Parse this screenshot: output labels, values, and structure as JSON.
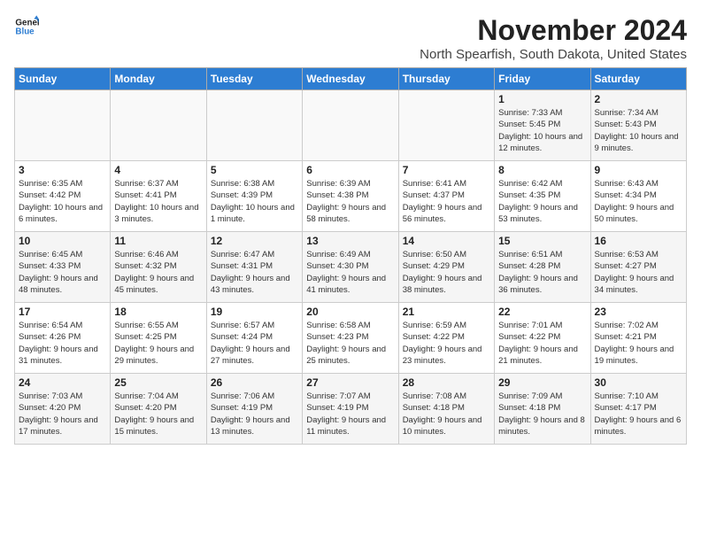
{
  "header": {
    "logo_line1": "General",
    "logo_line2": "Blue",
    "month_title": "November 2024",
    "location": "North Spearfish, South Dakota, United States"
  },
  "days_of_week": [
    "Sunday",
    "Monday",
    "Tuesday",
    "Wednesday",
    "Thursday",
    "Friday",
    "Saturday"
  ],
  "weeks": [
    [
      {
        "day": "",
        "info": ""
      },
      {
        "day": "",
        "info": ""
      },
      {
        "day": "",
        "info": ""
      },
      {
        "day": "",
        "info": ""
      },
      {
        "day": "",
        "info": ""
      },
      {
        "day": "1",
        "info": "Sunrise: 7:33 AM\nSunset: 5:45 PM\nDaylight: 10 hours and 12 minutes."
      },
      {
        "day": "2",
        "info": "Sunrise: 7:34 AM\nSunset: 5:43 PM\nDaylight: 10 hours and 9 minutes."
      }
    ],
    [
      {
        "day": "3",
        "info": "Sunrise: 6:35 AM\nSunset: 4:42 PM\nDaylight: 10 hours and 6 minutes."
      },
      {
        "day": "4",
        "info": "Sunrise: 6:37 AM\nSunset: 4:41 PM\nDaylight: 10 hours and 3 minutes."
      },
      {
        "day": "5",
        "info": "Sunrise: 6:38 AM\nSunset: 4:39 PM\nDaylight: 10 hours and 1 minute."
      },
      {
        "day": "6",
        "info": "Sunrise: 6:39 AM\nSunset: 4:38 PM\nDaylight: 9 hours and 58 minutes."
      },
      {
        "day": "7",
        "info": "Sunrise: 6:41 AM\nSunset: 4:37 PM\nDaylight: 9 hours and 56 minutes."
      },
      {
        "day": "8",
        "info": "Sunrise: 6:42 AM\nSunset: 4:35 PM\nDaylight: 9 hours and 53 minutes."
      },
      {
        "day": "9",
        "info": "Sunrise: 6:43 AM\nSunset: 4:34 PM\nDaylight: 9 hours and 50 minutes."
      }
    ],
    [
      {
        "day": "10",
        "info": "Sunrise: 6:45 AM\nSunset: 4:33 PM\nDaylight: 9 hours and 48 minutes."
      },
      {
        "day": "11",
        "info": "Sunrise: 6:46 AM\nSunset: 4:32 PM\nDaylight: 9 hours and 45 minutes."
      },
      {
        "day": "12",
        "info": "Sunrise: 6:47 AM\nSunset: 4:31 PM\nDaylight: 9 hours and 43 minutes."
      },
      {
        "day": "13",
        "info": "Sunrise: 6:49 AM\nSunset: 4:30 PM\nDaylight: 9 hours and 41 minutes."
      },
      {
        "day": "14",
        "info": "Sunrise: 6:50 AM\nSunset: 4:29 PM\nDaylight: 9 hours and 38 minutes."
      },
      {
        "day": "15",
        "info": "Sunrise: 6:51 AM\nSunset: 4:28 PM\nDaylight: 9 hours and 36 minutes."
      },
      {
        "day": "16",
        "info": "Sunrise: 6:53 AM\nSunset: 4:27 PM\nDaylight: 9 hours and 34 minutes."
      }
    ],
    [
      {
        "day": "17",
        "info": "Sunrise: 6:54 AM\nSunset: 4:26 PM\nDaylight: 9 hours and 31 minutes."
      },
      {
        "day": "18",
        "info": "Sunrise: 6:55 AM\nSunset: 4:25 PM\nDaylight: 9 hours and 29 minutes."
      },
      {
        "day": "19",
        "info": "Sunrise: 6:57 AM\nSunset: 4:24 PM\nDaylight: 9 hours and 27 minutes."
      },
      {
        "day": "20",
        "info": "Sunrise: 6:58 AM\nSunset: 4:23 PM\nDaylight: 9 hours and 25 minutes."
      },
      {
        "day": "21",
        "info": "Sunrise: 6:59 AM\nSunset: 4:22 PM\nDaylight: 9 hours and 23 minutes."
      },
      {
        "day": "22",
        "info": "Sunrise: 7:01 AM\nSunset: 4:22 PM\nDaylight: 9 hours and 21 minutes."
      },
      {
        "day": "23",
        "info": "Sunrise: 7:02 AM\nSunset: 4:21 PM\nDaylight: 9 hours and 19 minutes."
      }
    ],
    [
      {
        "day": "24",
        "info": "Sunrise: 7:03 AM\nSunset: 4:20 PM\nDaylight: 9 hours and 17 minutes."
      },
      {
        "day": "25",
        "info": "Sunrise: 7:04 AM\nSunset: 4:20 PM\nDaylight: 9 hours and 15 minutes."
      },
      {
        "day": "26",
        "info": "Sunrise: 7:06 AM\nSunset: 4:19 PM\nDaylight: 9 hours and 13 minutes."
      },
      {
        "day": "27",
        "info": "Sunrise: 7:07 AM\nSunset: 4:19 PM\nDaylight: 9 hours and 11 minutes."
      },
      {
        "day": "28",
        "info": "Sunrise: 7:08 AM\nSunset: 4:18 PM\nDaylight: 9 hours and 10 minutes."
      },
      {
        "day": "29",
        "info": "Sunrise: 7:09 AM\nSunset: 4:18 PM\nDaylight: 9 hours and 8 minutes."
      },
      {
        "day": "30",
        "info": "Sunrise: 7:10 AM\nSunset: 4:17 PM\nDaylight: 9 hours and 6 minutes."
      }
    ]
  ]
}
